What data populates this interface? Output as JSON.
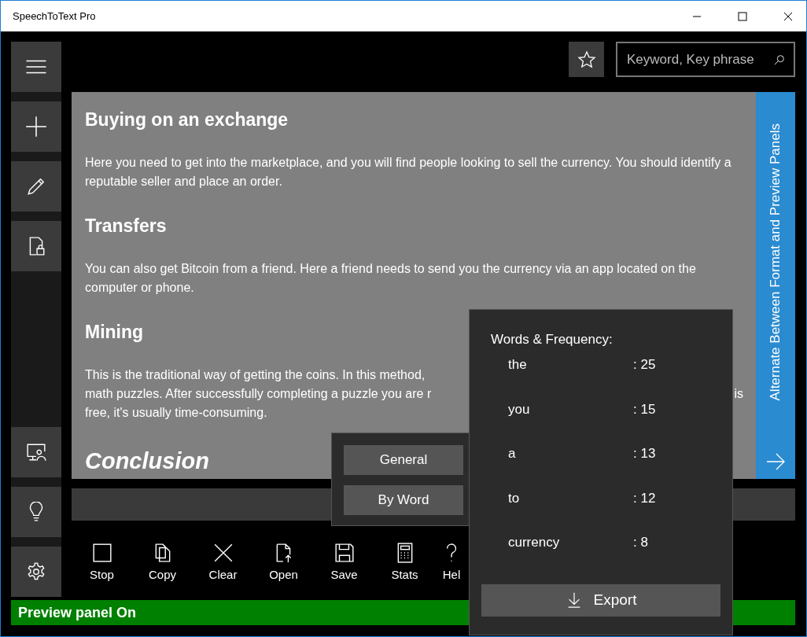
{
  "window": {
    "title": "SpeechToText Pro"
  },
  "search": {
    "placeholder": "Keyword, Key phrase"
  },
  "document": {
    "blocks": [
      {
        "kind": "heading",
        "text": "Buying on an exchange"
      },
      {
        "kind": "paragraph",
        "text": "Here you need to get into the marketplace, and you will find people looking to sell the currency. You should identify a reputable seller and place an order."
      },
      {
        "kind": "heading",
        "text": "Transfers"
      },
      {
        "kind": "paragraph",
        "text": "You can also get Bitcoin from a friend. Here a friend needs to send you the currency via an app located on the computer or phone."
      },
      {
        "kind": "heading",
        "text": "Mining"
      },
      {
        "kind": "lines",
        "lines": [
          {
            "text": "This is the traditional way of getting the coins. In this method,"
          },
          {
            "text": "math puzzles. After successfully completing a puzzle you are r",
            "tail": "is"
          },
          {
            "text": "free, it's usually time-consuming."
          }
        ]
      },
      {
        "kind": "subtitle",
        "text": "Conclusion"
      }
    ]
  },
  "side_panel": {
    "label": "Alternate Between Format and Preview Panels"
  },
  "toolbar": [
    {
      "kind": "stop",
      "label": "Stop"
    },
    {
      "kind": "copy",
      "label": "Copy"
    },
    {
      "kind": "clear",
      "label": "Clear"
    },
    {
      "kind": "open",
      "label": "Open"
    },
    {
      "kind": "save",
      "label": "Save"
    },
    {
      "kind": "stats",
      "label": "Stats"
    },
    {
      "kind": "help",
      "label": "Hel"
    }
  ],
  "status_bar": {
    "text": "Preview panel On"
  },
  "stats_menu": {
    "options": [
      {
        "label": "General"
      },
      {
        "label": "By Word"
      }
    ]
  },
  "frequency": {
    "title": "Words & Frequency:",
    "rows": [
      {
        "word": "the",
        "count": ": 25"
      },
      {
        "word": "you",
        "count": ": 15"
      },
      {
        "word": "a",
        "count": ": 13"
      },
      {
        "word": "to",
        "count": ": 12"
      },
      {
        "word": "currency",
        "count": ": 8"
      }
    ],
    "export": "Export"
  }
}
